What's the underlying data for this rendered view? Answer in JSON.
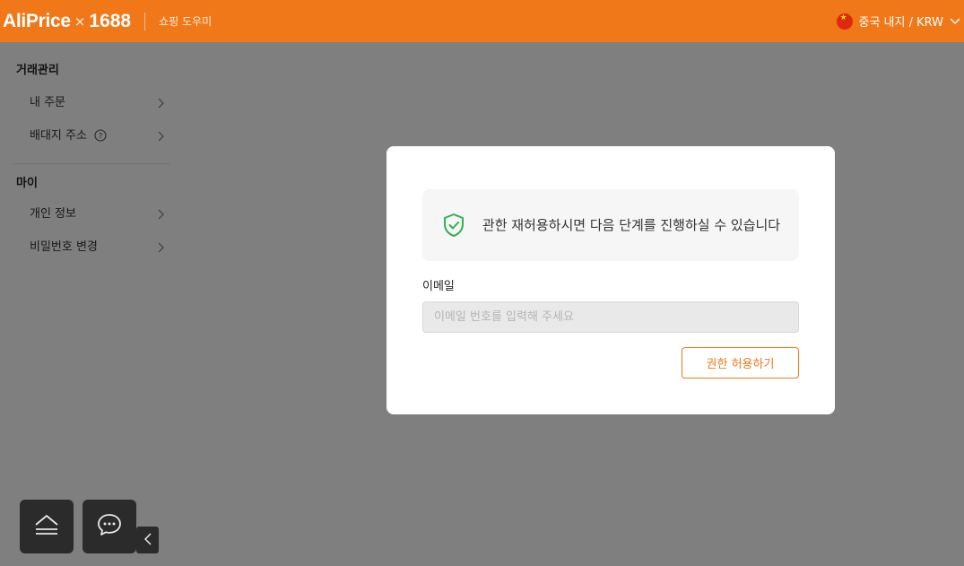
{
  "header": {
    "brand": "AliPrice",
    "times": "×",
    "partner": "1688",
    "tagline": "쇼핑 도우미",
    "region": "중국 내지 / KRW"
  },
  "sidebar": {
    "sections": [
      {
        "title": "거래관리",
        "items": [
          {
            "label": "내 주문"
          },
          {
            "label": "배대지 주소"
          }
        ]
      },
      {
        "title": "마이",
        "items": [
          {
            "label": "개인 정보"
          },
          {
            "label": "비밀번호 변경"
          }
        ]
      }
    ]
  },
  "modal": {
    "notice": "관한 재허용하시면 다음 단계를 진행하실 수 있습니다",
    "email_label": "이메일",
    "email_placeholder": "이메일 번호를 입력해 주세요",
    "email_value": "",
    "grant_button": "권한 허용하기"
  },
  "colors": {
    "brand_orange": "#f07819",
    "shield_green": "#2fb24c",
    "overlay": "rgba(0,0,0,0.5)"
  },
  "icons": {
    "flag": "china-flag-icon",
    "notice": "shield-check-icon",
    "float_left": "scroll-top-icon",
    "float_right": "chat-icon",
    "collapse": "chevron-left-icon"
  }
}
